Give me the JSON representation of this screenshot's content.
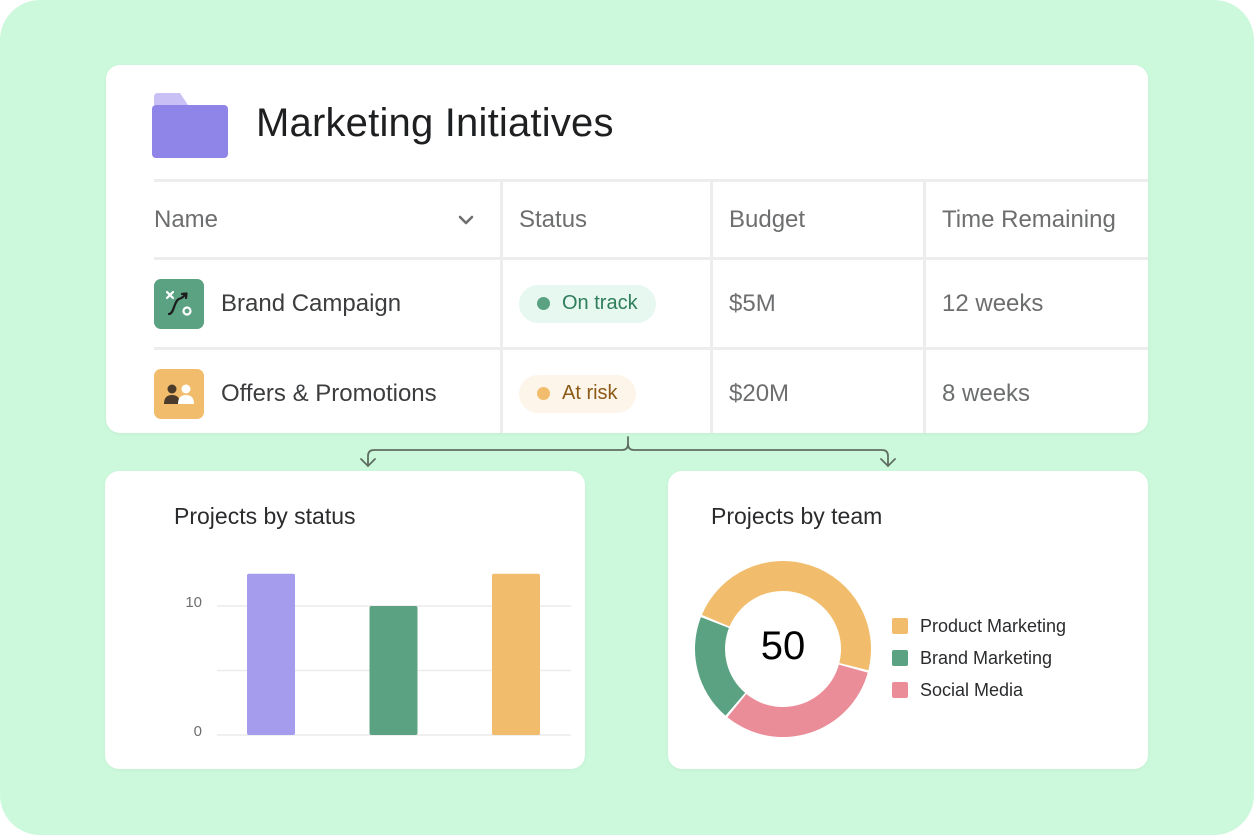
{
  "colors": {
    "background": "#ccf8dc",
    "folder": "#8f85e8",
    "folder_tab": "#c9c1f5",
    "green": "#5ba283",
    "orange": "#f1bd6c",
    "purple": "#a69cee",
    "pink": "#ea8d99",
    "connector": "#5f6e62"
  },
  "header": {
    "icon": "folder-icon",
    "title": "Marketing Initiatives"
  },
  "table": {
    "columns": [
      {
        "label": "Name",
        "icon": "chevron-down-icon"
      },
      {
        "label": "Status"
      },
      {
        "label": "Budget"
      },
      {
        "label": "Time Remaining"
      }
    ],
    "rows": [
      {
        "icon": "strategy-icon",
        "name": "Brand Campaign",
        "status": "On track",
        "status_color": "#5ba283",
        "budget": "$5M",
        "time_remaining": "12 weeks"
      },
      {
        "icon": "team-icon",
        "name": "Offers & Promotions",
        "status": "At risk",
        "status_color": "#f1bd6c",
        "budget": "$20M",
        "time_remaining": "8 weeks"
      }
    ]
  },
  "chart_data": [
    {
      "type": "bar",
      "title": "Projects by status",
      "categories": [
        "Purple",
        "Green",
        "Orange"
      ],
      "values": [
        12.5,
        10,
        12.5
      ],
      "colors": [
        "#a69cee",
        "#5ba283",
        "#f1bd6c"
      ],
      "yticks": [
        0,
        10
      ],
      "gridlines": [
        0,
        5,
        10
      ],
      "ylim": [
        0,
        12.5
      ],
      "xlabel": "",
      "ylabel": "",
      "grid": true
    },
    {
      "type": "pie",
      "variant": "donut",
      "title": "Projects by team",
      "center_label": "50",
      "labels": [
        "Product Marketing",
        "Social Media",
        "Brand Marketing"
      ],
      "values": [
        24,
        16,
        10
      ],
      "colors": [
        "#f1bd6c",
        "#ea8d99",
        "#5ba283"
      ],
      "legend": [
        {
          "label": "Product Marketing",
          "color": "#f1bd6c"
        },
        {
          "label": "Brand Marketing",
          "color": "#5ba283"
        },
        {
          "label": "Social Media",
          "color": "#ea8d99"
        }
      ],
      "legend_position": "right"
    }
  ]
}
